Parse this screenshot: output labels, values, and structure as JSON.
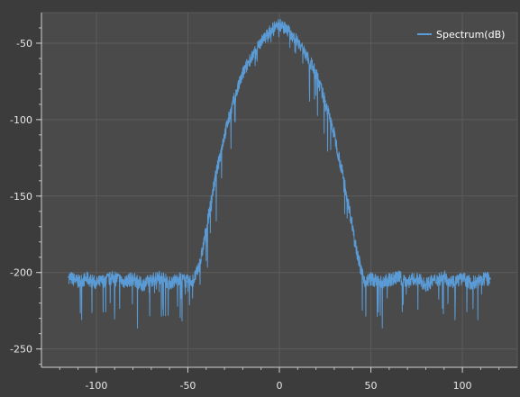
{
  "chart_data": {
    "type": "line",
    "title": "",
    "xlabel": "",
    "ylabel": "",
    "xlim": [
      -130,
      130
    ],
    "ylim": [
      -262,
      -30
    ],
    "x_ticks": [
      -100,
      -50,
      0,
      50,
      100
    ],
    "y_ticks": [
      -50,
      -100,
      -150,
      -200,
      -250
    ],
    "x_tick_labels": [
      "-100",
      "-50",
      "0",
      "50",
      "100"
    ],
    "y_tick_labels": [
      "-50",
      "-100",
      "-150",
      "-200",
      "-250"
    ],
    "grid": true,
    "legend_position": "top-right",
    "series": [
      {
        "name": "Spectrum(dB)",
        "color": "#5b9bd5",
        "x": [
          -115,
          -110,
          -105,
          -100,
          -95,
          -90,
          -85,
          -80,
          -75,
          -70,
          -65,
          -60,
          -55,
          -50,
          -47,
          -45,
          -43,
          -40,
          -35,
          -30,
          -25,
          -20,
          -15,
          -10,
          -5,
          -2,
          0,
          2,
          5,
          10,
          15,
          20,
          25,
          30,
          35,
          40,
          43,
          45,
          47,
          50,
          55,
          60,
          65,
          70,
          75,
          80,
          85,
          90,
          95,
          100,
          105,
          110,
          115
        ],
        "values": [
          -203,
          -206,
          -204,
          -207,
          -205,
          -203,
          -206,
          -204,
          -208,
          -205,
          -203,
          -207,
          -204,
          -206,
          -205,
          -200,
          -192,
          -172,
          -138,
          -110,
          -88,
          -70,
          -58,
          -49,
          -42,
          -39,
          -38,
          -39,
          -42,
          -49,
          -58,
          -70,
          -88,
          -110,
          -138,
          -170,
          -190,
          -200,
          -206,
          -204,
          -207,
          -205,
          -203,
          -206,
          -204,
          -208,
          -205,
          -203,
          -206,
          -204,
          -207,
          -205,
          -204
        ]
      }
    ]
  }
}
